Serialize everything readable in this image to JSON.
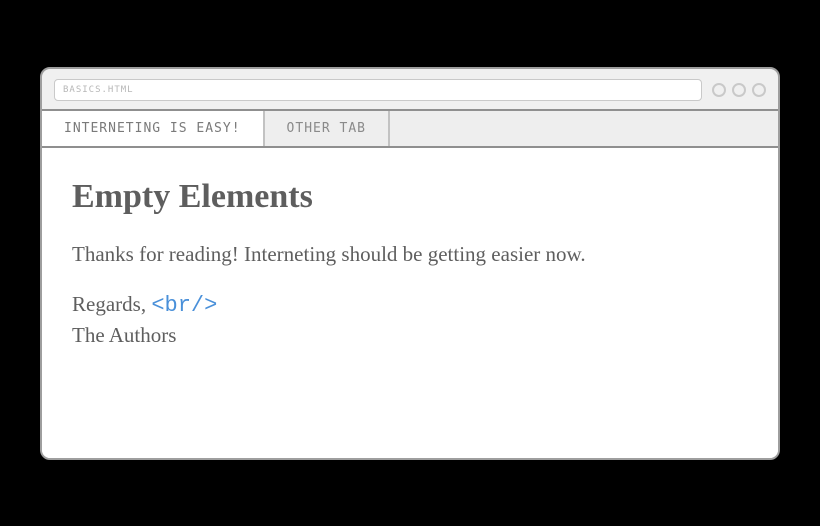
{
  "url_bar": {
    "value": "BASICS.HTML"
  },
  "tabs": [
    {
      "label": "INTERNETING IS EASY!",
      "active": true
    },
    {
      "label": "OTHER TAB",
      "active": false
    }
  ],
  "page": {
    "heading": "Empty Elements",
    "paragraph": "Thanks for reading! Interneting should be getting easier now.",
    "signoff_line1": "Regards, ",
    "code_tag": "<br/>",
    "signoff_line2": "The Authors"
  }
}
